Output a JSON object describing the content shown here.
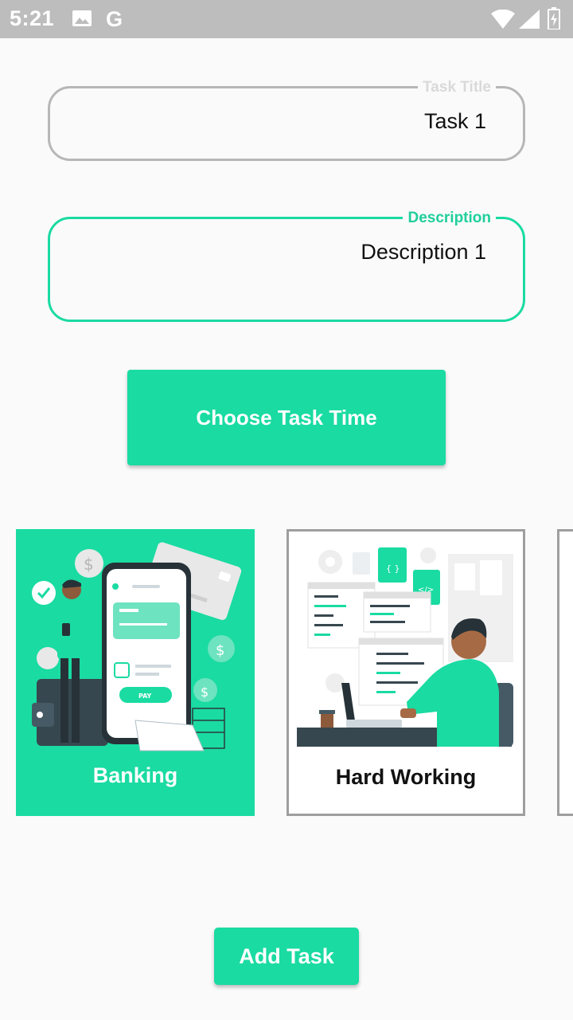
{
  "status_bar": {
    "time": "5:21",
    "g_glyph": "G"
  },
  "form": {
    "title_label": "Task Title",
    "title_value": "Task 1",
    "desc_label": "Description",
    "desc_value": "Description 1",
    "time_button": "Choose Task Time"
  },
  "categories": [
    {
      "label": "Banking",
      "selected": true
    },
    {
      "label": "Hard Working",
      "selected": false
    }
  ],
  "add_button": "Add Task",
  "colors": {
    "accent": "#1adba2",
    "status_bar": "#bdbdbd",
    "border_inactive": "#b7b7b7",
    "card_border": "#9e9e9e"
  }
}
